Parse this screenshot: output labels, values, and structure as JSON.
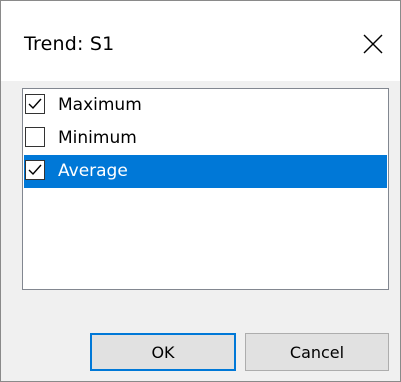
{
  "dialog": {
    "title": "Trend: S1",
    "close_icon": "close-icon"
  },
  "list": {
    "items": [
      {
        "label": "Maximum",
        "checked": true,
        "selected": false
      },
      {
        "label": "Minimum",
        "checked": false,
        "selected": false
      },
      {
        "label": "Average",
        "checked": true,
        "selected": true
      }
    ]
  },
  "buttons": {
    "ok_label": "OK",
    "cancel_label": "Cancel"
  },
  "colors": {
    "selection": "#0078d7",
    "dialog_background": "#f0f0f0"
  }
}
